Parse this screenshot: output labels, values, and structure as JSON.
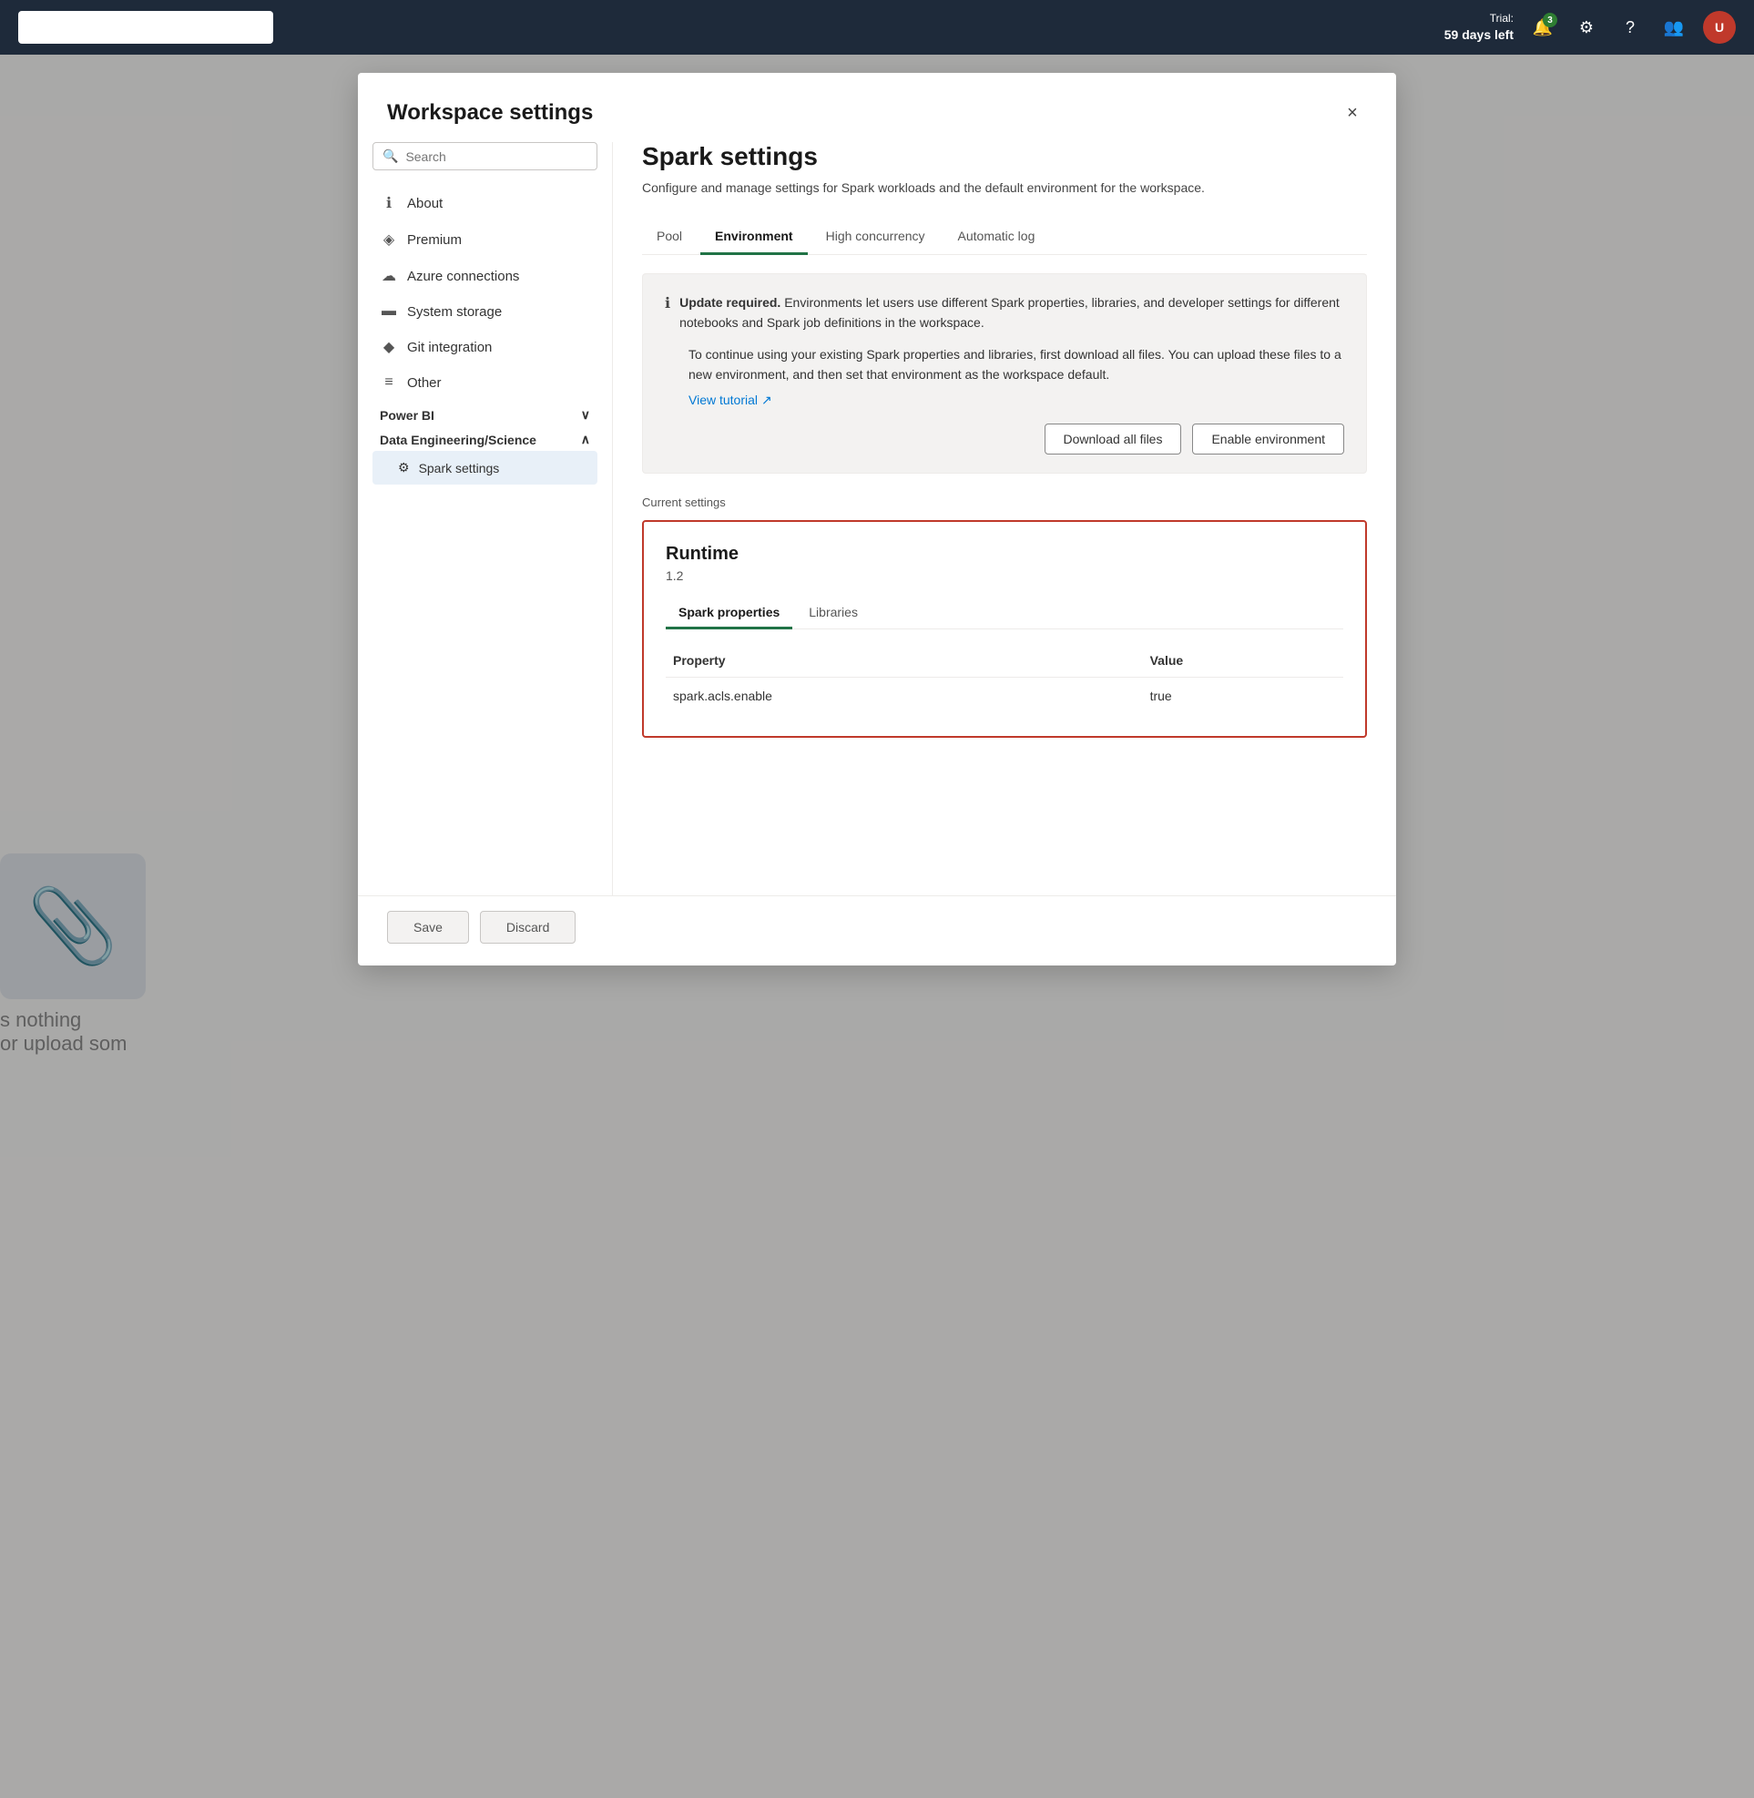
{
  "topbar": {
    "trial_label": "Trial:",
    "trial_days": "59 days left",
    "badge_count": "3",
    "avatar_initials": "U"
  },
  "modal": {
    "title": "Workspace settings",
    "close_label": "×"
  },
  "sidebar": {
    "search_placeholder": "Search",
    "nav_items": [
      {
        "id": "about",
        "label": "About",
        "icon": "ℹ"
      },
      {
        "id": "premium",
        "label": "Premium",
        "icon": "◈"
      },
      {
        "id": "azure",
        "label": "Azure connections",
        "icon": "☁"
      },
      {
        "id": "storage",
        "label": "System storage",
        "icon": "▬"
      },
      {
        "id": "git",
        "label": "Git integration",
        "icon": "◆"
      },
      {
        "id": "other",
        "label": "Other",
        "icon": "≡"
      }
    ],
    "sections": [
      {
        "id": "power-bi",
        "label": "Power BI",
        "expanded": false
      },
      {
        "id": "data-eng",
        "label": "Data Engineering/Science",
        "expanded": true
      }
    ],
    "active_item": "spark-settings",
    "sub_items": [
      {
        "id": "spark-settings",
        "label": "Spark settings",
        "icon": "⚙"
      }
    ]
  },
  "main": {
    "page_title": "Spark settings",
    "page_desc": "Configure and manage settings for Spark workloads and the default environment for the workspace.",
    "tabs": [
      {
        "id": "pool",
        "label": "Pool"
      },
      {
        "id": "environment",
        "label": "Environment",
        "active": true
      },
      {
        "id": "high-concurrency",
        "label": "High concurrency"
      },
      {
        "id": "automatic-log",
        "label": "Automatic log"
      }
    ],
    "banner": {
      "title_strong": "Update required.",
      "title_rest": " Environments let users use different Spark properties, libraries, and developer settings for different notebooks and Spark job definitions in the workspace.",
      "body": "To continue using your existing Spark properties and libraries, first download all files. You can upload these files to a new environment, and then set that environment as the workspace default.",
      "tutorial_link": "View tutorial",
      "btn_download": "Download all files",
      "btn_enable": "Enable environment"
    },
    "current_settings_label": "Current settings",
    "runtime": {
      "title": "Runtime",
      "version": "1.2",
      "inner_tabs": [
        {
          "id": "spark-props",
          "label": "Spark properties",
          "active": true
        },
        {
          "id": "libraries",
          "label": "Libraries"
        }
      ],
      "table": {
        "headers": [
          "Property",
          "Value"
        ],
        "rows": [
          {
            "property": "spark.acls.enable",
            "value": "true"
          }
        ]
      }
    },
    "footer": {
      "save_label": "Save",
      "discard_label": "Discard"
    }
  }
}
